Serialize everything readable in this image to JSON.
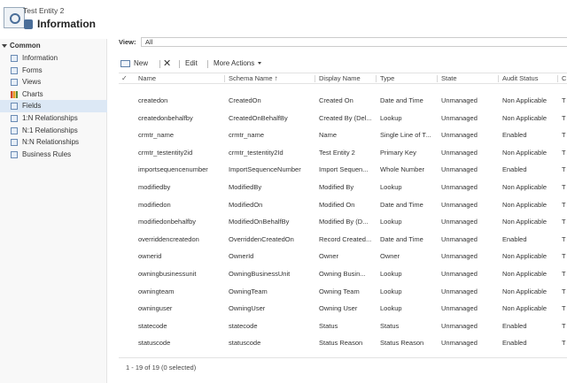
{
  "header": {
    "entity_name": "Test Entity 2",
    "title": "Information"
  },
  "sidebar": {
    "group_label": "Common",
    "items": [
      {
        "label": "Information",
        "icon": "form-icon"
      },
      {
        "label": "Forms",
        "icon": "forms-icon"
      },
      {
        "label": "Views",
        "icon": "views-icon"
      },
      {
        "label": "Charts",
        "icon": "charts-icon"
      },
      {
        "label": "Fields",
        "icon": "fields-icon",
        "selected": true
      },
      {
        "label": "1:N Relationships",
        "icon": "relationship-icon"
      },
      {
        "label": "N:1 Relationships",
        "icon": "relationship-icon"
      },
      {
        "label": "N:N Relationships",
        "icon": "relationship-icon"
      },
      {
        "label": "Business Rules",
        "icon": "business-rules-icon"
      }
    ]
  },
  "view": {
    "label": "View:",
    "selected": "All"
  },
  "toolbar": {
    "new_label": "New",
    "edit_label": "Edit",
    "more_actions_label": "More Actions"
  },
  "grid": {
    "columns": [
      "Name",
      "Schema Name",
      "Display Name",
      "Type",
      "State",
      "Audit Status",
      "C"
    ],
    "sorted_column": "Schema Name",
    "sort_direction": "ascending",
    "rows": [
      [
        "createdon",
        "CreatedOn",
        "Created On",
        "Date and Time",
        "Unmanaged",
        "Non Applicable",
        "T"
      ],
      [
        "createdonbehalfby",
        "CreatedOnBehalfBy",
        "Created By (Del...",
        "Lookup",
        "Unmanaged",
        "Non Applicable",
        "T"
      ],
      [
        "crmtr_name",
        "crmtr_name",
        "Name",
        "Single Line of T...",
        "Unmanaged",
        "Enabled",
        "T"
      ],
      [
        "crmtr_testentity2id",
        "crmtr_testentity2Id",
        "Test Entity 2",
        "Primary Key",
        "Unmanaged",
        "Non Applicable",
        "T"
      ],
      [
        "importsequencenumber",
        "ImportSequenceNumber",
        "Import Sequen...",
        "Whole Number",
        "Unmanaged",
        "Enabled",
        "T"
      ],
      [
        "modifiedby",
        "ModifiedBy",
        "Modified By",
        "Lookup",
        "Unmanaged",
        "Non Applicable",
        "T"
      ],
      [
        "modifiedon",
        "ModifiedOn",
        "Modified On",
        "Date and Time",
        "Unmanaged",
        "Non Applicable",
        "T"
      ],
      [
        "modifiedonbehalfby",
        "ModifiedOnBehalfBy",
        "Modified By (D...",
        "Lookup",
        "Unmanaged",
        "Non Applicable",
        "T"
      ],
      [
        "overriddencreatedon",
        "OverriddenCreatedOn",
        "Record Created...",
        "Date and Time",
        "Unmanaged",
        "Enabled",
        "T"
      ],
      [
        "ownerid",
        "OwnerId",
        "Owner",
        "Owner",
        "Unmanaged",
        "Non Applicable",
        "T"
      ],
      [
        "owningbusinessunit",
        "OwningBusinessUnit",
        "Owning Busin...",
        "Lookup",
        "Unmanaged",
        "Non Applicable",
        "T"
      ],
      [
        "owningteam",
        "OwningTeam",
        "Owning Team",
        "Lookup",
        "Unmanaged",
        "Non Applicable",
        "T"
      ],
      [
        "owninguser",
        "OwningUser",
        "Owning User",
        "Lookup",
        "Unmanaged",
        "Non Applicable",
        "T"
      ],
      [
        "statecode",
        "statecode",
        "Status",
        "Status",
        "Unmanaged",
        "Enabled",
        "T"
      ],
      [
        "statuscode",
        "statuscode",
        "Status Reason",
        "Status Reason",
        "Unmanaged",
        "Enabled",
        "T"
      ]
    ]
  },
  "footer": {
    "status": "1 - 19 of 19 (0 selected)"
  },
  "colors": {
    "selected_nav_bg": "#dce8f5",
    "accent": "#4a6e99"
  }
}
